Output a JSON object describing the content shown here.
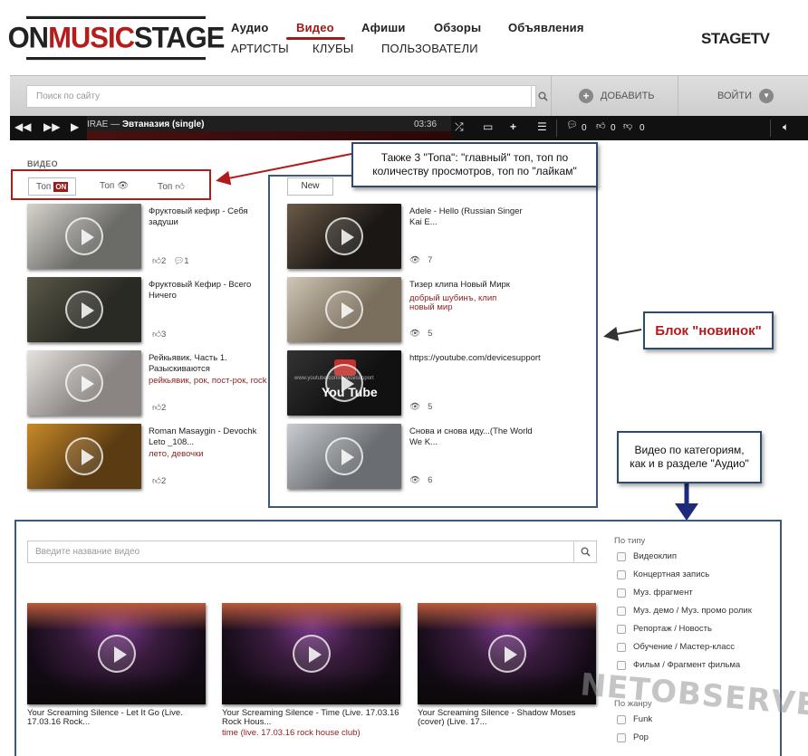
{
  "logo": {
    "part1": "ON",
    "part2": "MUSIC",
    "part3": "STAGE"
  },
  "nav": {
    "row1": [
      "Аудио",
      "Видео",
      "Афиши",
      "Обзоры",
      "Объявления"
    ],
    "row2": [
      "АРТИСТЫ",
      "КЛУБЫ",
      "ПОЛЬЗОВАТЕЛИ"
    ],
    "active": "Видео"
  },
  "stagetv": "STAGETV",
  "searchbar": {
    "placeholder": "Поиск по сайту",
    "add_label": "ДОБАВИТЬ",
    "login_label": "ВОЙТИ"
  },
  "player": {
    "artist": "IRAE",
    "dash": " — ",
    "track": "Эвтаназия (single)",
    "time": "03:36",
    "comments": "0",
    "likes": "0",
    "dislikes": "0"
  },
  "video": {
    "section_title": "ВИДЕО",
    "tabs": {
      "top_main": "Топ",
      "top_main_badge": "ON",
      "top_views": "Топ",
      "top_likes": "Топ"
    },
    "left_items": [
      {
        "title": "Фруктовый кефир - Себя задуши",
        "tags": "",
        "likes": "2",
        "comments": "1",
        "thumb_colors": [
          "#6b6b68",
          "#d8d4cc"
        ]
      },
      {
        "title": "Фруктовый Кефир - Всего Ничего",
        "tags": "",
        "likes": "3",
        "comments": "",
        "thumb_colors": [
          "#2a2a24",
          "#5a5848"
        ]
      },
      {
        "title": "Рейкьявик. Часть 1. Разыскиваются",
        "tags": "рейкьявик, рок, пост-рок, rock",
        "likes": "2",
        "comments": "",
        "thumb_colors": [
          "#8a8582",
          "#e6e2de"
        ]
      },
      {
        "title": "Roman Masaygin - Devochk Leto _108...",
        "tags": "лето, девочки",
        "likes": "2",
        "comments": "",
        "thumb_colors": [
          "#5a3b12",
          "#c88a2a"
        ]
      }
    ],
    "new_label": "New",
    "new_items": [
      {
        "title": "Adele - Hello (Russian Singer Kai E...",
        "tags": "",
        "views": "7",
        "thumb_colors": [
          "#1a1714",
          "#6b5a48"
        ]
      },
      {
        "title": "Тизер клипа Новый Мирк",
        "tags": "добрый шубинъ, клип новый мир",
        "views": "5",
        "thumb_colors": [
          "#7a6e5c",
          "#cfc7b6"
        ]
      },
      {
        "title": "https://youtube.com/devicesupport",
        "tags": "",
        "views": "5",
        "thumb_colors": [
          "#111111",
          "#333333"
        ]
      },
      {
        "title": "Снова и снова иду...(The World We K...",
        "tags": "",
        "views": "6",
        "thumb_colors": [
          "#6a6e72",
          "#c9ccd0"
        ]
      }
    ],
    "youtube_text": "You Tube",
    "youtube_url": "www.youtube.com/devicesupport"
  },
  "callouts": {
    "tops": "Также 3 \"Топа\": \"главный\" топ, топ по количеству просмотров, топ по \"лайкам\"",
    "novinok": "Блок \"новинок\"",
    "categories": "Видео по категориям, как и в разделе \"Аудио\""
  },
  "categories": {
    "search_placeholder": "Введите название видео",
    "items": [
      {
        "title": "Your Screaming Silence - Let It Go (Live. 17.03.16 Rock...",
        "tags": ""
      },
      {
        "title": "Your Screaming Silence - Time (Live. 17.03.16 Rock Hous...",
        "tags": "time (live. 17.03.16 rock house club)"
      },
      {
        "title": "Your Screaming Silence - Shadow Moses (cover) (Live. 17...",
        "tags": ""
      }
    ],
    "filter_type_title": "По типу",
    "filter_types": [
      "Видеоклип",
      "Концертная запись",
      "Муз. фрагмент",
      "Муз. демо / Муз. промо ролик",
      "Репортаж / Новость",
      "Обучение / Мастер-класс",
      "Фильм / Фрагмент фильма"
    ],
    "filter_genre_title": "По жанру",
    "filter_genres": [
      "Funk",
      "Pop"
    ]
  },
  "watermark": "NETOBSERVER.RU",
  "colors": {
    "accent": "#a01919",
    "callout_border": "#2e4a6a",
    "highlight_red": "#b11b1b"
  }
}
